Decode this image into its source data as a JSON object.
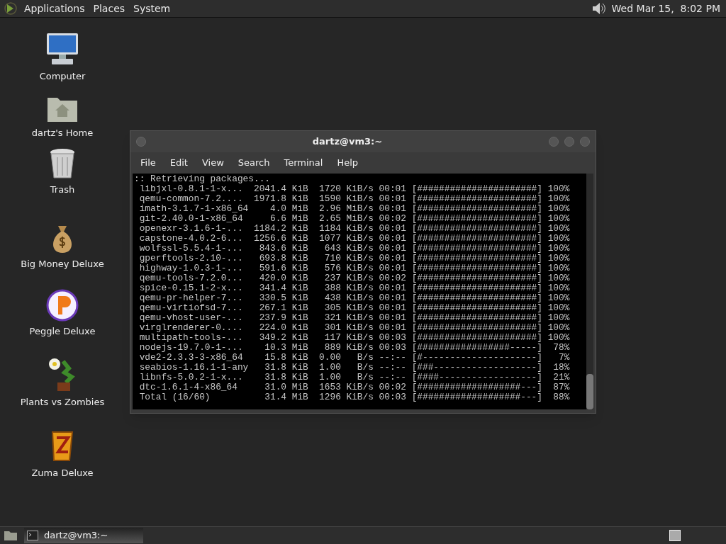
{
  "top_panel": {
    "menus": [
      "Applications",
      "Places",
      "System"
    ],
    "clock": "Wed Mar 15,  8:02 PM"
  },
  "desktop_icons": [
    {
      "label": "Computer",
      "kind": "computer"
    },
    {
      "label": "dartz's Home",
      "kind": "folder"
    },
    {
      "label": "Trash",
      "kind": "trash"
    },
    {
      "label": "Big Money Deluxe",
      "kind": "moneybag"
    },
    {
      "label": "Peggle Deluxe",
      "kind": "ball"
    },
    {
      "label": "Plants vs Zombies",
      "kind": "plant"
    },
    {
      "label": "Zuma Deluxe",
      "kind": "zuma"
    }
  ],
  "window": {
    "title": "dartz@vm3:~",
    "menu": [
      "File",
      "Edit",
      "View",
      "Search",
      "Terminal",
      "Help"
    ],
    "lines": [
      ":: Retrieving packages...",
      " libjxl-0.8.1-1-x...  2041.4 KiB  1720 KiB/s 00:01 [######################] 100%",
      " qemu-common-7.2....  1971.8 KiB  1590 KiB/s 00:01 [######################] 100%",
      " imath-3.1.7-1-x86_64    4.0 MiB  2.96 MiB/s 00:01 [######################] 100%",
      " git-2.40.0-1-x86_64     6.6 MiB  2.65 MiB/s 00:02 [######################] 100%",
      " openexr-3.1.6-1-...  1184.2 KiB  1184 KiB/s 00:01 [######################] 100%",
      " capstone-4.0.2-6...  1256.6 KiB  1077 KiB/s 00:01 [######################] 100%",
      " wolfssl-5.5.4-1-...   843.6 KiB   643 KiB/s 00:01 [######################] 100%",
      " gperftools-2.10-...   693.8 KiB   710 KiB/s 00:01 [######################] 100%",
      " highway-1.0.3-1-...   591.6 KiB   576 KiB/s 00:01 [######################] 100%",
      " qemu-tools-7.2.0...   420.0 KiB   237 KiB/s 00:02 [######################] 100%",
      " spice-0.15.1-2-x...   341.4 KiB   388 KiB/s 00:01 [######################] 100%",
      " qemu-pr-helper-7...   330.5 KiB   438 KiB/s 00:01 [######################] 100%",
      " qemu-virtiofsd-7...   267.1 KiB   305 KiB/s 00:01 [######################] 100%",
      " qemu-vhost-user-...   237.9 KiB   321 KiB/s 00:01 [######################] 100%",
      " virglrenderer-0....   224.0 KiB   301 KiB/s 00:01 [######################] 100%",
      " multipath-tools-...   349.2 KiB   117 KiB/s 00:03 [######################] 100%",
      " nodejs-19.7.0-1-...    10.3 MiB   889 KiB/s 00:03 [#################-----]  78%",
      " vde2-2.3.3-3-x86_64    15.8 KiB  0.00   B/s --:-- [#---------------------]   7%",
      " seabios-1.16.1-1-any   31.8 KiB  1.00   B/s --:-- [###-------------------]  18%",
      " libnfs-5.0.2-1-x...    31.8 KiB  1.00   B/s --:-- [####------------------]  21%",
      " dtc-1.6.1-4-x86_64     31.0 MiB  1653 KiB/s 00:02 [###################---]  87%",
      " Total (16/60)          31.4 MiB  1296 KiB/s 00:03 [###################---]  88%"
    ]
  },
  "taskbar": {
    "tasks": [
      {
        "label": "dartz@vm3:~",
        "selected": true
      }
    ]
  }
}
